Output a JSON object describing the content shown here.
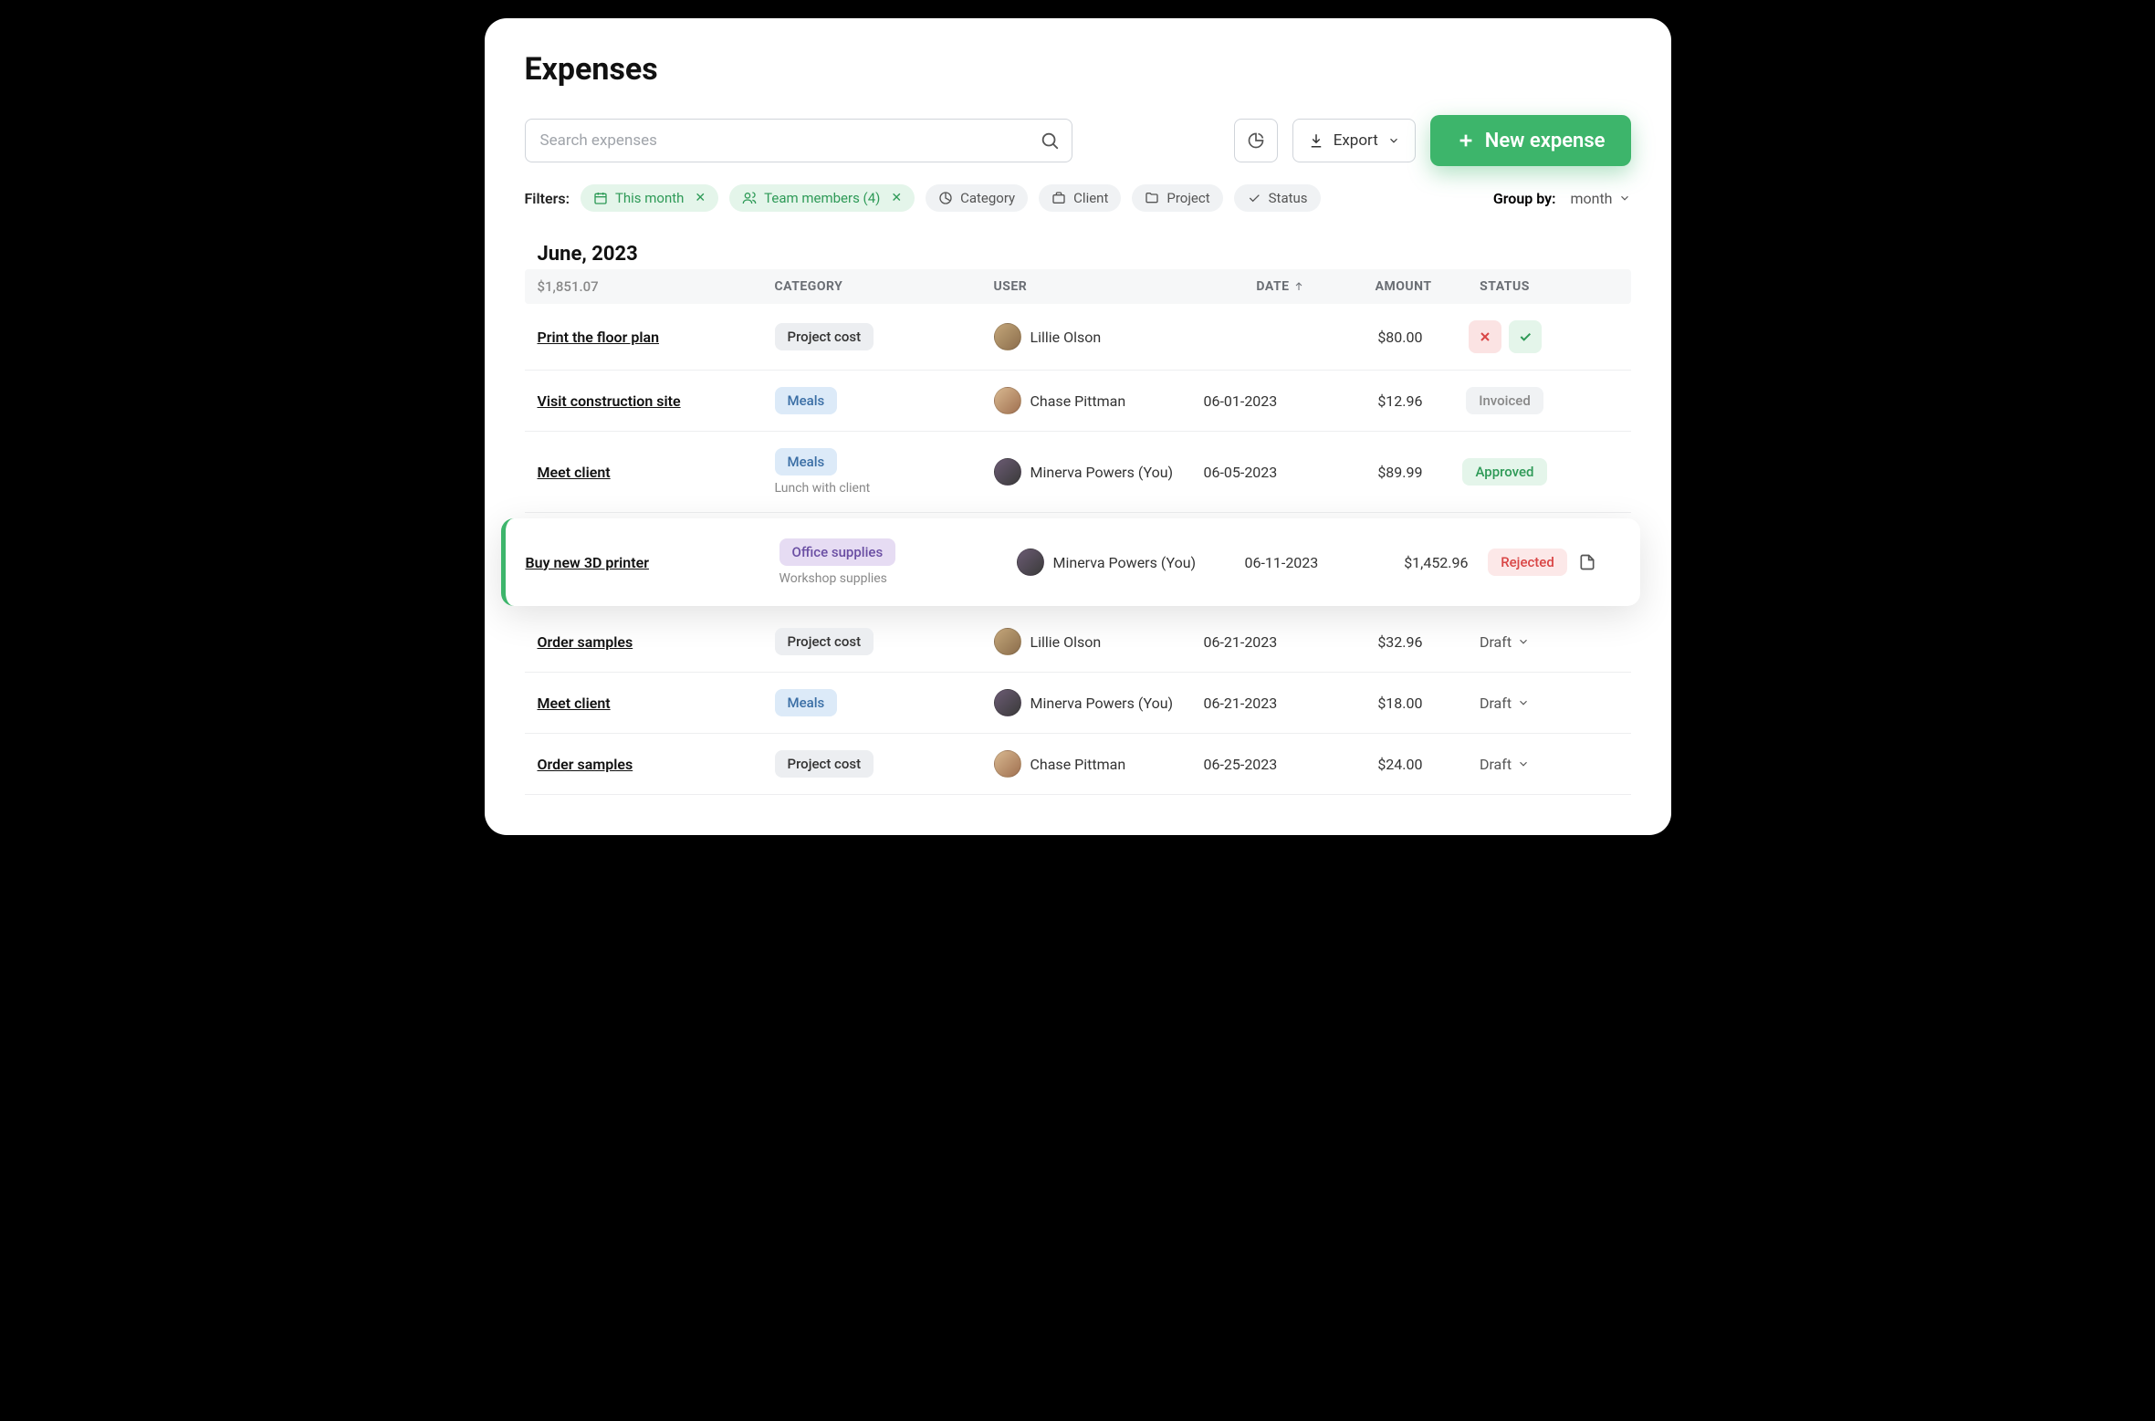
{
  "page": {
    "title": "Expenses"
  },
  "search": {
    "placeholder": "Search expenses"
  },
  "toolbar": {
    "export": "Export",
    "new_expense": "New expense"
  },
  "filters": {
    "label": "Filters:",
    "this_month": "This month",
    "team_members": "Team members (4)",
    "category": "Category",
    "client": "Client",
    "project": "Project",
    "status": "Status"
  },
  "groupby": {
    "label": "Group by:",
    "value": "month"
  },
  "group": {
    "title": "June, 2023",
    "total": "$1,851.07"
  },
  "columns": {
    "category": "CATEGORY",
    "user": "USER",
    "date": "DATE",
    "amount": "AMOUNT",
    "status": "STATUS"
  },
  "rows": [
    {
      "name": "Print the floor plan",
      "category": "Project cost",
      "cat_type": "project",
      "sub": "",
      "user": "Lillie Olson",
      "avatar": "a1",
      "date": "",
      "amount": "$80.00",
      "status": "actions"
    },
    {
      "name": "Visit construction site",
      "category": "Meals",
      "cat_type": "meals",
      "sub": "",
      "user": "Chase Pittman",
      "avatar": "a2",
      "date": "06-01-2023",
      "amount": "$12.96",
      "status": "Invoiced"
    },
    {
      "name": "Meet client ",
      "category": "Meals",
      "cat_type": "meals",
      "sub": "Lunch with client",
      "user": "Minerva Powers (You)",
      "avatar": "a3",
      "date": "06-05-2023",
      "amount": "$89.99",
      "status": "Approved"
    },
    {
      "name": "Buy new 3D printer",
      "category": "Office supplies",
      "cat_type": "office",
      "sub": "Workshop supplies",
      "user": "Minerva Powers (You)",
      "avatar": "a3",
      "date": "06-11-2023",
      "amount": "$1,452.96",
      "status": "Rejected",
      "highlighted": true
    },
    {
      "name": "Order samples",
      "category": "Project cost",
      "cat_type": "project",
      "sub": "",
      "user": "Lillie Olson",
      "avatar": "a1",
      "date": "06-21-2023",
      "amount": "$32.96",
      "status": "Draft"
    },
    {
      "name": "Meet client",
      "category": "Meals",
      "cat_type": "meals",
      "sub": "",
      "user": "Minerva Powers (You)",
      "avatar": "a3",
      "date": "06-21-2023",
      "amount": "$18.00",
      "status": "Draft"
    },
    {
      "name": "Order samples",
      "category": "Project cost",
      "cat_type": "project",
      "sub": "",
      "user": "Chase Pittman",
      "avatar": "a2",
      "date": "06-25-2023",
      "amount": "$24.00",
      "status": "Draft"
    }
  ]
}
